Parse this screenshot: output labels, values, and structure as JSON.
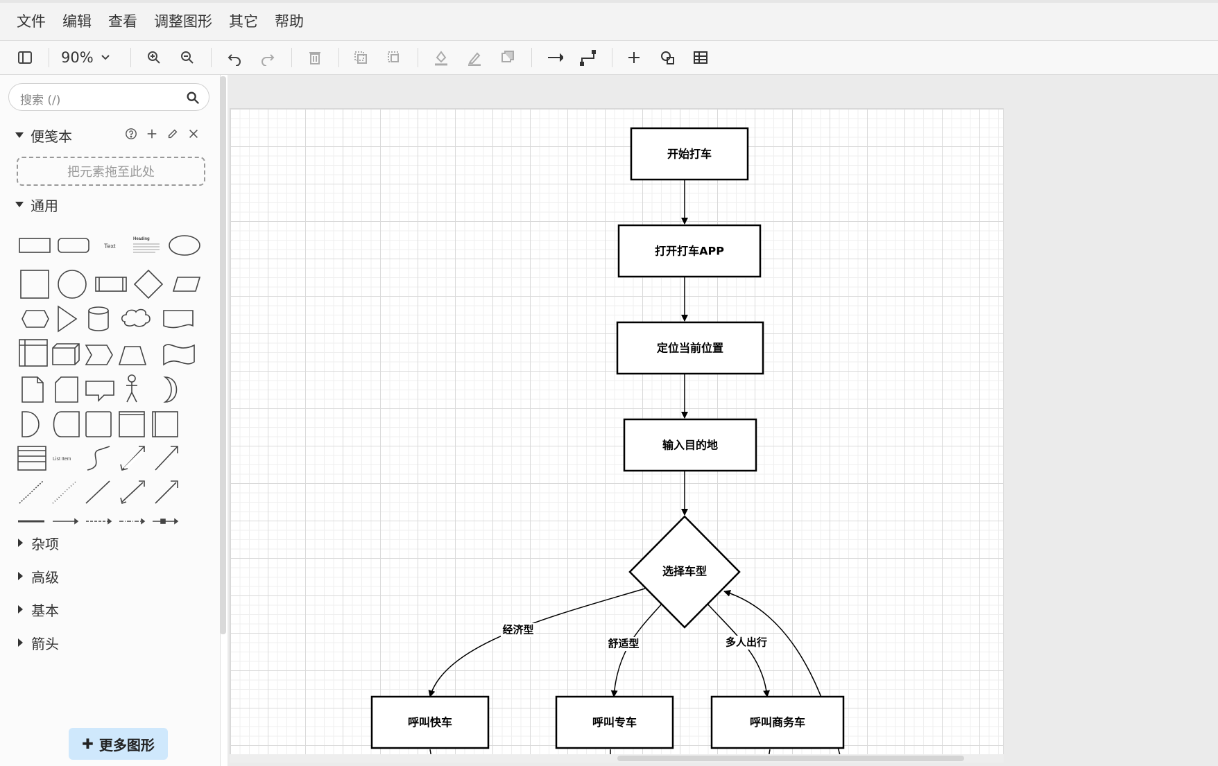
{
  "menubar": {
    "items": [
      "文件",
      "编辑",
      "查看",
      "调整图形",
      "其它",
      "帮助"
    ]
  },
  "toolbar": {
    "zoom": "90%",
    "icons": [
      "sidebar-toggle-icon",
      "zoom-in-icon",
      "zoom-out-icon",
      "undo-icon",
      "redo-icon",
      "delete-icon",
      "to-front-icon",
      "to-back-icon",
      "fill-color-icon",
      "line-color-icon",
      "shadow-icon",
      "connection-icon",
      "waypoints-icon",
      "insert-icon",
      "shapes-icon",
      "table-icon"
    ]
  },
  "sidebar": {
    "search_placeholder": "搜索 (/)",
    "scratchpad_title": "便笺本",
    "dropzone_text": "把元素拖至此处",
    "general_title": "通用",
    "shape_text_label": "Text",
    "shape_heading_label": "Heading",
    "shape_list_item_label": "List Item",
    "collapsed_sections": [
      "杂项",
      "高级",
      "基本",
      "箭头"
    ],
    "more_shapes": "更多图形"
  },
  "diagram": {
    "nodes": {
      "start": "开始打车",
      "open_app": "打开打车APP",
      "locate": "定位当前位置",
      "destination": "输入目的地",
      "choose_type": "选择车型",
      "express": "呼叫快车",
      "premium": "呼叫专车",
      "business": "呼叫商务车"
    },
    "edge_labels": {
      "economy": "经济型",
      "comfort": "舒适型",
      "group": "多人出行"
    }
  }
}
